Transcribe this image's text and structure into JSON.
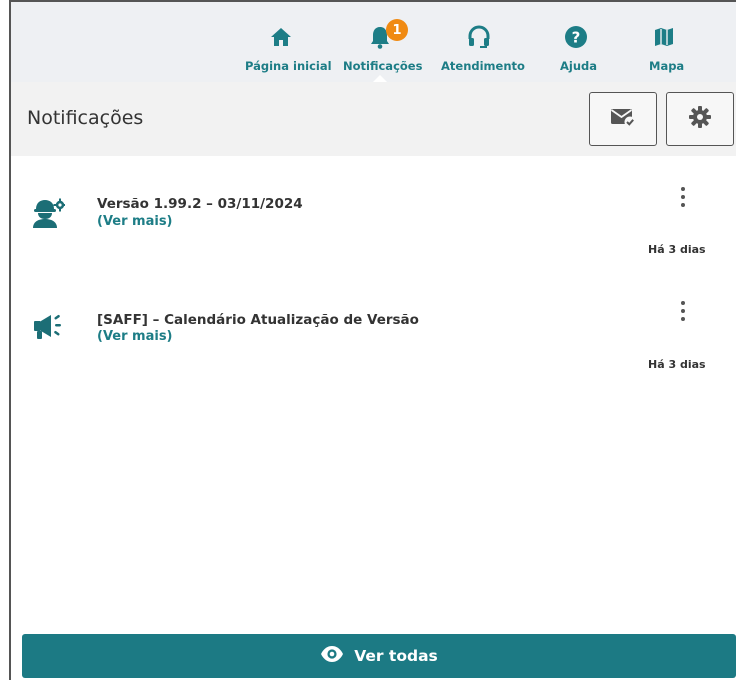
{
  "colors": {
    "accent": "#1d7d86",
    "badge": "#f08a12",
    "button": "#1c7a84",
    "nav_bg": "#eef0f3",
    "header_bg": "#f2f2f2"
  },
  "nav": {
    "items": [
      {
        "label": "Página inicial",
        "icon": "home-icon"
      },
      {
        "label": "Notificações",
        "icon": "bell-icon",
        "badge": "1",
        "active": true
      },
      {
        "label": "Atendimento",
        "icon": "headset-icon"
      },
      {
        "label": "Ajuda",
        "icon": "help-icon"
      },
      {
        "label": "Mapa",
        "icon": "map-icon"
      }
    ]
  },
  "header": {
    "title": "Notificações",
    "buttons": [
      {
        "icon": "mark-all-read-icon"
      },
      {
        "icon": "settings-gear-icon"
      }
    ]
  },
  "notifications": [
    {
      "icon": "support-agent-gear-icon",
      "title": "Versão 1.99.2 – 03/11/2024",
      "more": "(Ver mais)",
      "time": "Há 3 dias"
    },
    {
      "icon": "megaphone-icon",
      "title": "[SAFF] – Calendário Atualização de Versão",
      "more": "(Ver mais)",
      "time": "Há 3 dias"
    }
  ],
  "footer": {
    "view_all_label": "Ver todas",
    "view_all_icon": "eye-icon"
  }
}
